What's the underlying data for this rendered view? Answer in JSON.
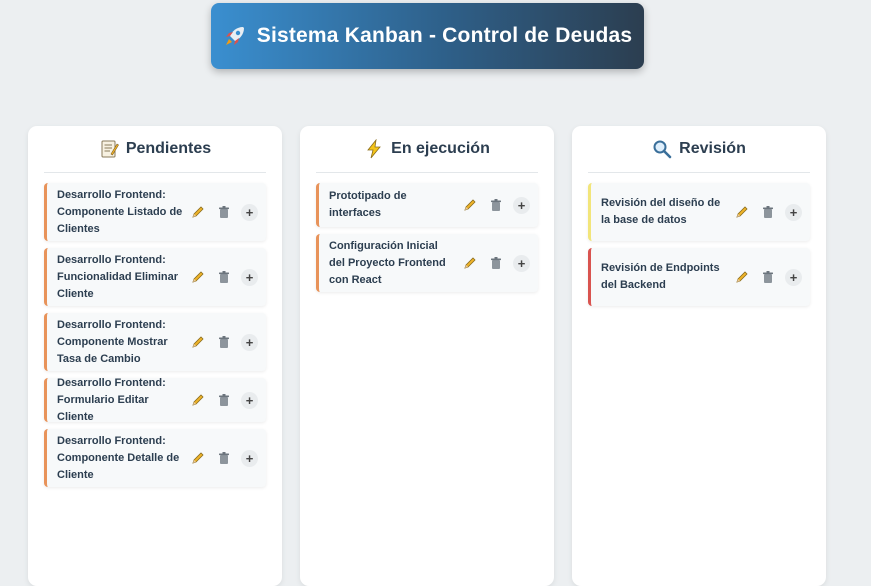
{
  "header": {
    "title": "Sistema Kanban - Control de Deudas",
    "icon": "rocket-icon"
  },
  "columns": [
    {
      "title": "Pendientes",
      "icon": "memo-icon",
      "cards": [
        {
          "text": "Desarrollo Frontend: Componente Listado de Clientes",
          "color": "#e8935a"
        },
        {
          "text": "Desarrollo Frontend: Funcionalidad Eliminar Cliente",
          "color": "#e8935a"
        },
        {
          "text": "Desarrollo Frontend: Componente Mostrar Tasa de Cambio",
          "color": "#e8935a"
        },
        {
          "text": "Desarrollo Frontend: Formulario Editar Cliente",
          "color": "#e8935a"
        },
        {
          "text": "Desarrollo Frontend: Componente Detalle de Cliente",
          "color": "#e8935a"
        }
      ]
    },
    {
      "title": "En ejecución",
      "icon": "lightning-icon",
      "cards": [
        {
          "text": "Prototipado de interfaces",
          "color": "#e8935a"
        },
        {
          "text": "Configuración Inicial del Proyecto Frontend con React",
          "color": "#e8935a"
        }
      ]
    },
    {
      "title": "Revisión",
      "icon": "magnifier-icon",
      "cards": [
        {
          "text": "Revisión del diseño de la base de datos",
          "color": "#f2e57a"
        },
        {
          "text": "Revisión de Endpoints del Backend",
          "color": "#d9534f"
        }
      ]
    }
  ],
  "actions": {
    "edit_icon": "pencil-icon",
    "delete_icon": "trash-icon",
    "add_label": "+"
  }
}
